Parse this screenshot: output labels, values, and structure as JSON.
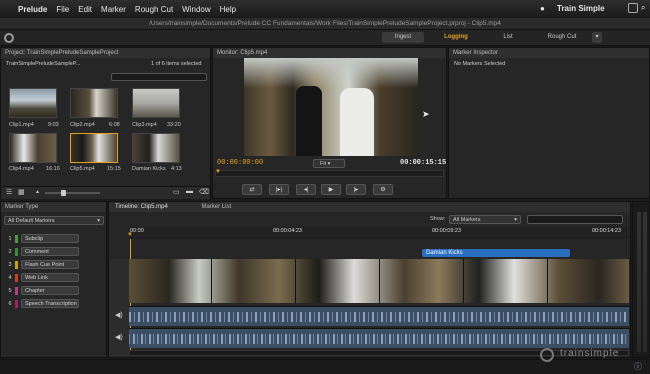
{
  "menubar": {
    "apple": "",
    "app": "Prelude",
    "items": [
      "File",
      "Edit",
      "Marker",
      "Rough Cut",
      "Window",
      "Help"
    ],
    "brand": "Train Simple"
  },
  "title": "/Users/trainsimple/Documents/Prelude CC Fundamentals/Work Files/TrainSimplePreludeSampleProject.prproj - Clip5.mp4",
  "workspaces": {
    "ingest": "Ingest",
    "logging": "Logging",
    "list": "List",
    "rough_cut": "Rough Cut"
  },
  "project": {
    "title": "Project: TrainSimplePreludeSampleProject",
    "name": "TrainSimplePreludeSampleP...",
    "count": "1 of 6 items selected",
    "clips": [
      {
        "name": "Clip1.mp4",
        "dur": "9:03"
      },
      {
        "name": "Clip2.mp4",
        "dur": "6:08"
      },
      {
        "name": "Clip3.mp4",
        "dur": "33:20"
      },
      {
        "name": "Clip4.mp4",
        "dur": "16:16"
      },
      {
        "name": "Clip5.mp4",
        "dur": "15:15"
      },
      {
        "name": "Damian Kicks",
        "dur": "4:13"
      }
    ]
  },
  "monitor": {
    "title": "Monitor: Clip5.mp4",
    "current": "00:00:00:00",
    "fit": "Fit",
    "duration": "00:00:15:15"
  },
  "inspector": {
    "title": "Marker Inspector",
    "empty": "No Markers Selected"
  },
  "marker_type": {
    "title": "Marker Type",
    "filter": "All Default Markers",
    "items": [
      {
        "num": "1",
        "label": "Subclip",
        "color": "#4a9a3c"
      },
      {
        "num": "2",
        "label": "Comment",
        "color": "#3c8a3c"
      },
      {
        "num": "3",
        "label": "Flash Cue Point",
        "color": "#c8a020"
      },
      {
        "num": "4",
        "label": "Web Link",
        "color": "#c84020"
      },
      {
        "num": "5",
        "label": "Chapter",
        "color": "#b04080"
      },
      {
        "num": "6",
        "label": "Speech Transcription",
        "color": "#a02060"
      }
    ]
  },
  "timeline": {
    "title": "Timeline: Clip5.mp4",
    "marker_list": "Marker List",
    "show_label": "Show:",
    "show_value": "All Markers",
    "ticks": [
      "00:00",
      "00:00:04:23",
      "00:00:09:23",
      "00:00:14:23"
    ],
    "subclip": "Damian Kicks"
  },
  "watermark": "trainsimple"
}
